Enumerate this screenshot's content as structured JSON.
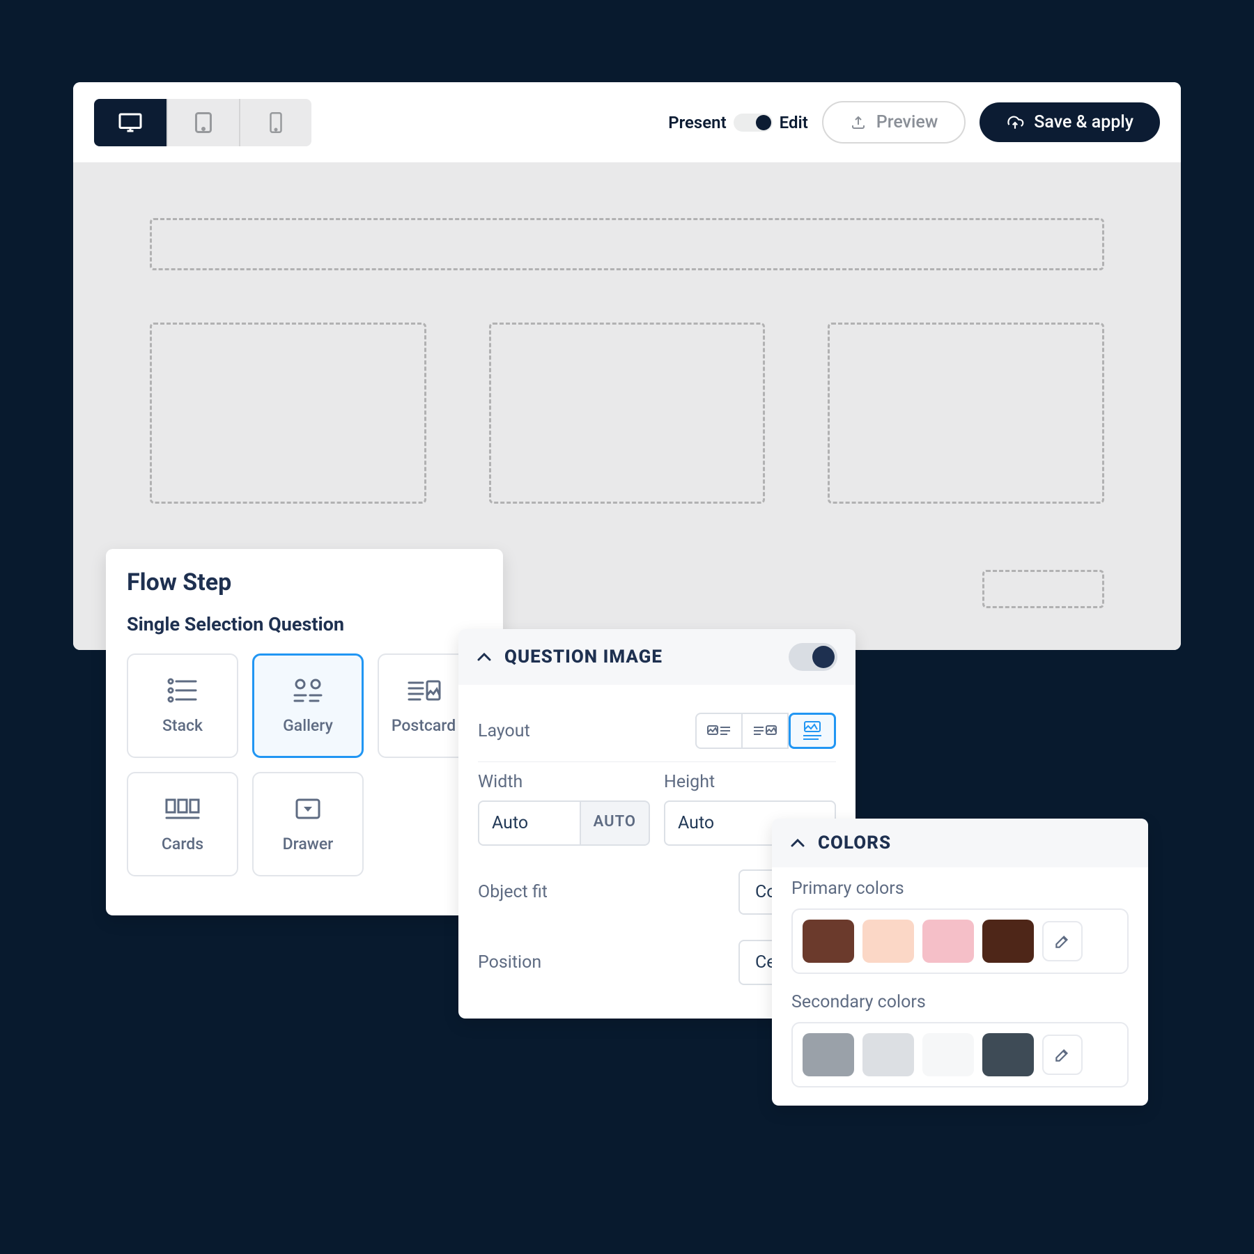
{
  "toolbar": {
    "devices": [
      "desktop",
      "tablet",
      "mobile"
    ],
    "toggle_left": "Present",
    "toggle_right": "Edit",
    "preview_label": "Preview",
    "save_label": "Save & apply"
  },
  "flow_step": {
    "title": "Flow Step",
    "subtitle": "Single Selection Question",
    "tiles": [
      {
        "label": "Stack",
        "icon": "stack"
      },
      {
        "label": "Gallery",
        "icon": "gallery",
        "selected": true
      },
      {
        "label": "Postcard",
        "icon": "postcard",
        "truncated": true
      },
      {
        "label": "Cards",
        "icon": "cards"
      },
      {
        "label": "Drawer",
        "icon": "drawer"
      }
    ]
  },
  "question_image": {
    "header": "QUESTION IMAGE",
    "enabled": true,
    "layout_label": "Layout",
    "layout_options": [
      "image-left",
      "image-right",
      "image-top"
    ],
    "layout_selected": 2,
    "width_label": "Width",
    "width_value": "Auto",
    "width_unit": "AUTO",
    "height_label": "Height",
    "height_value": "Auto",
    "object_fit_label": "Object fit",
    "object_fit_value": "Cover",
    "position_label": "Position",
    "position_value": "Center"
  },
  "colors": {
    "header": "COLORS",
    "primary_label": "Primary colors",
    "primary_swatches": [
      "#6b3a2c",
      "#fbd7c6",
      "#f5bfc8",
      "#4e2618"
    ],
    "secondary_label": "Secondary colors",
    "secondary_swatches": [
      "#9aa1a9",
      "#dcdfe3",
      "#f6f7f8",
      "#3e4b56"
    ]
  }
}
